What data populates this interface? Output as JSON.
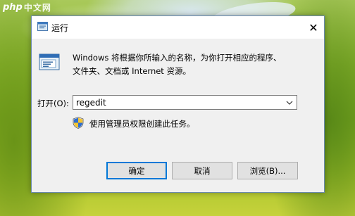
{
  "watermark": {
    "logo": "php",
    "text": "中文网"
  },
  "dialog": {
    "title": "运行",
    "close_glyph": "✕",
    "description": "Windows 将根据你所输入的名称，为你打开相应的程序、文件夹、文档或 Internet 资源。",
    "description_line1": "Windows 将根据你所输入的名称，为你打开相应的程序、",
    "description_line2": "文件夹、文档或 Internet 资源。",
    "open_label": "打开(O):",
    "command_value": "regedit",
    "admin_notice": "使用管理员权限创建此任务。",
    "buttons": {
      "ok": "确定",
      "cancel": "取消",
      "browse": "浏览(B)..."
    }
  },
  "icons": {
    "title": "run-icon",
    "app": "run-app-icon",
    "shield": "uac-shield-icon",
    "dropdown": "chevron-down-icon",
    "close": "close-icon"
  },
  "colors": {
    "accent": "#0078d7",
    "dialog_bg": "#f0f0f0",
    "titlebar_bg": "#ffffff",
    "button_bg": "#e1e1e1"
  }
}
